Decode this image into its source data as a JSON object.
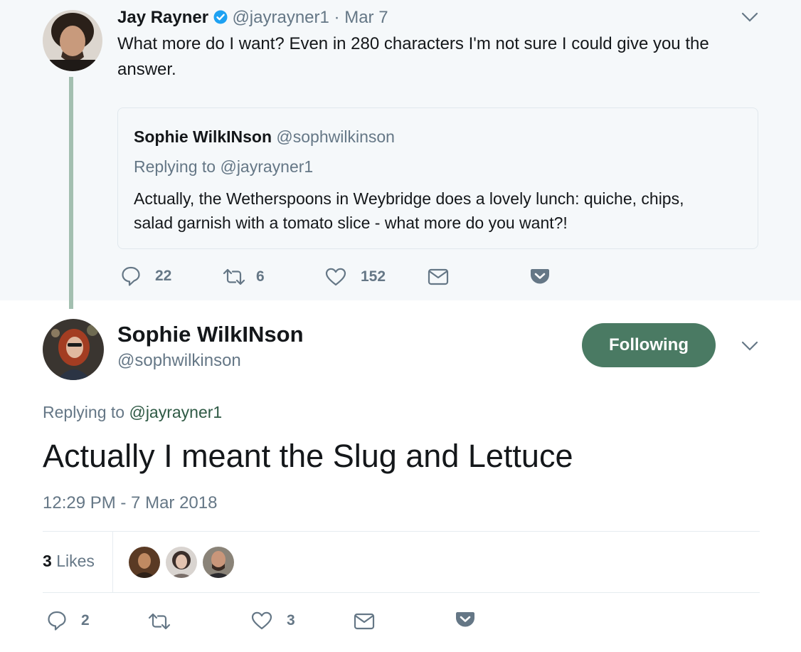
{
  "parent_tweet": {
    "author_name": "Jay Rayner",
    "handle": "@jayrayner1",
    "separator": "·",
    "date": "Mar 7",
    "text_line1": "What more do I want? Even in 280 characters I'm not sure I could give you the",
    "text_line2": "answer.",
    "quoted": {
      "author_name": "Sophie WilkINson",
      "handle": "@sophwilkinson",
      "replying_prefix": "Replying to",
      "replying_handle": "@jayrayner1",
      "text_line1": "Actually, the Wetherspoons in Weybridge does a lovely lunch: quiche, chips,",
      "text_line2": "salad garnish with a tomato slice - what more do you want?!"
    },
    "actions": {
      "replies": "22",
      "retweets": "6",
      "likes": "152"
    }
  },
  "main_tweet": {
    "author_name": "Sophie WilkINson",
    "handle": "@sophwilkinson",
    "follow_label": "Following",
    "replying_prefix": "Replying to",
    "replying_handle": "@jayrayner1",
    "text": "Actually I meant the Slug and Lettuce",
    "timestamp": "12:29 PM - 7 Mar 2018",
    "likes_count": "3",
    "likes_label": "Likes",
    "actions": {
      "replies": "2",
      "retweets": "",
      "likes": "3"
    }
  },
  "colors": {
    "thread_line": "#a3bfb0",
    "follow_button": "#4a7a63",
    "mention_link": "#2f5a45",
    "verified_badge": "#1da1f2",
    "muted_text": "#657786"
  },
  "icons": [
    "verified-badge-icon",
    "chevron-down-icon",
    "reply-icon",
    "retweet-icon",
    "heart-icon",
    "direct-message-icon",
    "pocket-icon"
  ]
}
